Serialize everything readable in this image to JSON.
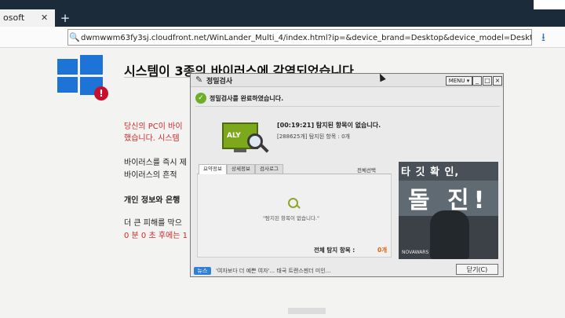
{
  "browser": {
    "tab_title": "osoft",
    "tab_close": "✕",
    "new_tab": "+",
    "address": "dwmwwm63fy3sj.cloudfront.net/WinLander_Multi_4/index.html?ip=&device_brand=Desktop&device_model=Desktop&browser_na"
  },
  "page": {
    "headline": "시스템이 3종의 바이러스에 감염되었습니다",
    "para1_line1": "당신의 PC이 바이",
    "para1_line2": "했습니다. 시스템",
    "para2_line1": "바이러스를 즉시 제",
    "para2_line2": "바이러스의 흔적",
    "para3": "개인 정보와 은행",
    "para4_line1": "더 큰 피해를 막으",
    "para4_line2": "0 분 0 초 후에는 1"
  },
  "dialog": {
    "title": "정밀검사",
    "menu_label": "MENU",
    "btn_min": "_",
    "btn_max": "□",
    "btn_close": "×",
    "done_text": "정밀검사를 완료하였습니다.",
    "monitor_label": "ALY",
    "result_line": "[00:19:21]  탐지된 항목이 없습니다.",
    "scanned_line": "[288625개] 탐지된 항목 : 0개",
    "tabs": [
      "요약정보",
      "상세정보",
      "검사로그"
    ],
    "select_all": "전체선택",
    "no_items": "\"탐지된 항목이 없습니다.\"",
    "total_label": "전체 탐지 항목 :",
    "total_count": "0개",
    "ad_title1": "타 깃 확 인,",
    "ad_title2": "돌 진!",
    "ad_brand": "NOVAWARS",
    "news_label": "뉴스",
    "news_text": "'여자보다 더 예쁜 여자'... 태국 트랜스젠더 미인...",
    "close_button": "닫기(C)"
  }
}
